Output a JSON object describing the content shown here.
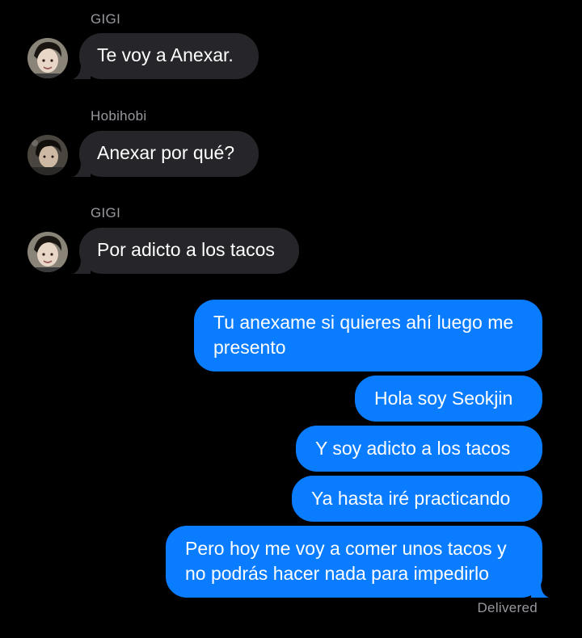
{
  "conversation": {
    "incoming": [
      {
        "sender": "GIGI",
        "avatar_icon": "profile-photo-icon",
        "text": "Te voy a Anexar."
      },
      {
        "sender": "Hobihobi",
        "avatar_icon": "profile-photo-icon",
        "text": "Anexar por qué?"
      },
      {
        "sender": "GIGI",
        "avatar_icon": "profile-photo-icon",
        "text": "Por adicto a los tacos"
      }
    ],
    "outgoing": [
      {
        "text": "Tu anexame si quieres ahí luego me presento"
      },
      {
        "text": "Hola soy Seokjin"
      },
      {
        "text": "Y soy adicto a los tacos"
      },
      {
        "text": "Ya hasta iré practicando"
      },
      {
        "text": "Pero hoy me voy a comer unos tacos y no podrás hacer nada para impedirlo"
      }
    ],
    "status": "Delivered"
  },
  "colors": {
    "background": "#000000",
    "incoming_bubble": "#26252a",
    "outgoing_bubble": "#0a7cff",
    "meta_text": "#98989f"
  }
}
